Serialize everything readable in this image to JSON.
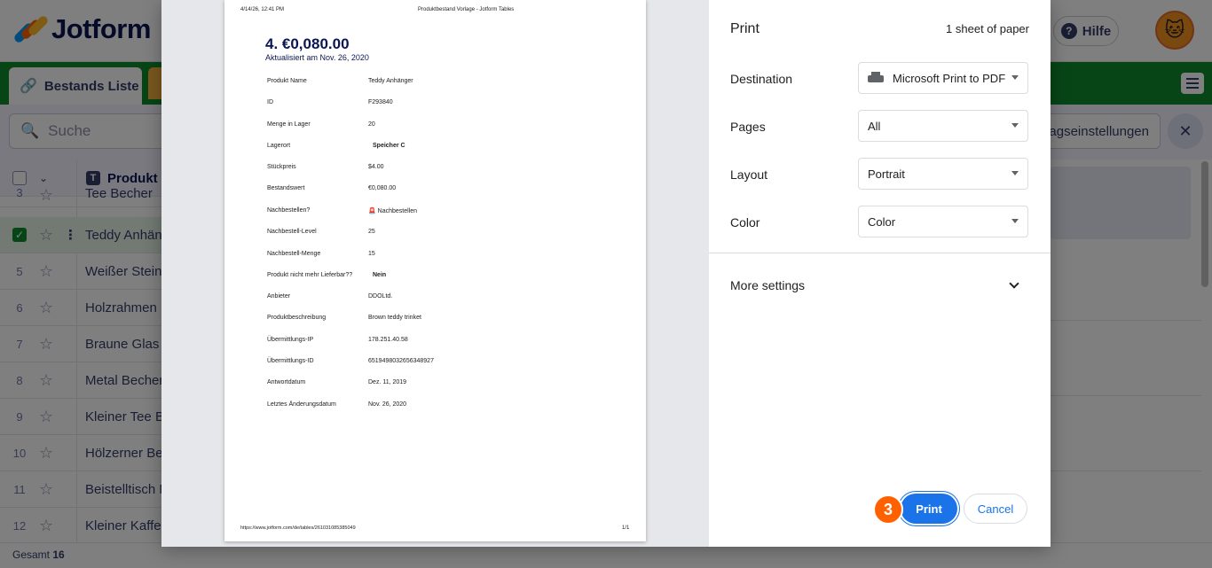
{
  "app": {
    "logo_text": "Jotform",
    "help_label": "Hilfe",
    "tab_label": "Bestands Liste",
    "search_placeholder": "Suche",
    "settings_label": "ragseinstellungen",
    "column_header": "Produkt N",
    "footer_label": "Gesamt",
    "footer_count": "16",
    "rows": [
      {
        "num": "3",
        "name": "Tee Becher"
      },
      {
        "num": "",
        "name": "Teddy Anhäng"
      },
      {
        "num": "5",
        "name": "Weißer Steing"
      },
      {
        "num": "6",
        "name": "Holzrahmen"
      },
      {
        "num": "7",
        "name": "Braune Glas V"
      },
      {
        "num": "8",
        "name": "Metal Becher"
      },
      {
        "num": "9",
        "name": "Kleiner Tee Be"
      },
      {
        "num": "10",
        "name": "Hölzerner Bei"
      },
      {
        "num": "11",
        "name": "Beistelltisch M"
      },
      {
        "num": "12",
        "name": "Kleiner Kaffee"
      }
    ]
  },
  "preview": {
    "header_left": "4/14/26, 12:41 PM",
    "header_center": "Produktbestand Vorlage - Jotform Tables",
    "value": "4. €0,080.00",
    "updated": "Aktualisiert am Nov. 26, 2020",
    "fields": [
      {
        "label": "Produkt Name",
        "value": "Teddy Anhänger"
      },
      {
        "label": "ID",
        "value": "F293840"
      },
      {
        "label": "Menge in Lager",
        "value": "20"
      },
      {
        "label": "Lagerort",
        "value": "Speicher C"
      },
      {
        "label": "Stückpreis",
        "value": "$4.00"
      },
      {
        "label": "Bestandswert",
        "value": "€0,080.00"
      },
      {
        "label": "Nachbestellen?",
        "value": "🚨 Nachbestellen"
      },
      {
        "label": "Nachbestell-Level",
        "value": "25"
      },
      {
        "label": "Nachbestell-Menge",
        "value": "15"
      },
      {
        "label": "Produkt nicht mehr Lieferbar??",
        "value": "Nein"
      },
      {
        "label": "Anbieter",
        "value": "DDOLtd."
      },
      {
        "label": "Produktbeschreibung",
        "value": "Brown teddy trinket"
      },
      {
        "label": "Übermittlungs-IP",
        "value": "178.251.40.58"
      },
      {
        "label": "Übermittlungs-ID",
        "value": "6519498032656348927"
      },
      {
        "label": "Antwortdatum",
        "value": "Dez. 11, 2019"
      },
      {
        "label": "Letztes Änderungsdatum",
        "value": "Nov. 26, 2020"
      }
    ],
    "footer_url": "https://www.jotform.com/de/tables/261031085385049",
    "footer_page": "1/1"
  },
  "print": {
    "title": "Print",
    "sheets": "1 sheet of paper",
    "destination_label": "Destination",
    "destination_value": "Microsoft Print to PDF",
    "pages_label": "Pages",
    "pages_value": "All",
    "layout_label": "Layout",
    "layout_value": "Portrait",
    "color_label": "Color",
    "color_value": "Color",
    "more_settings": "More settings",
    "print_button": "Print",
    "cancel_button": "Cancel",
    "step_number": "3"
  }
}
